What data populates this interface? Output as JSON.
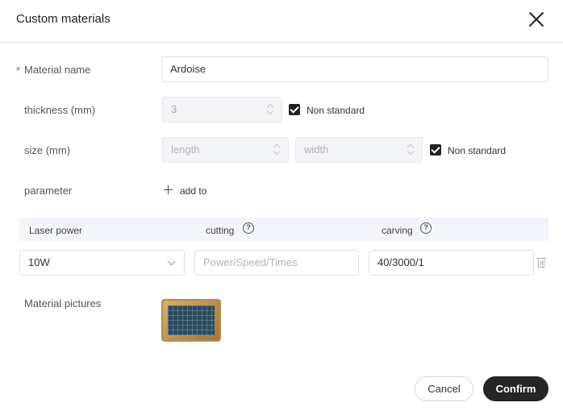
{
  "dialog": {
    "title": "Custom materials",
    "close_icon": "close-icon"
  },
  "form": {
    "material_name": {
      "required_mark": "*",
      "label": "Material name",
      "value": "Ardoise"
    },
    "thickness": {
      "label": "thickness (mm)",
      "value": "3",
      "non_standard_label": "Non standard",
      "non_standard_checked": true
    },
    "size": {
      "label": "size (mm)",
      "length_placeholder": "length",
      "width_placeholder": "width",
      "non_standard_label": "Non standard",
      "non_standard_checked": true
    },
    "parameter": {
      "label": "parameter",
      "add_label": "add to",
      "add_icon": "plus-icon"
    }
  },
  "table": {
    "headers": [
      "Laser power",
      "cutting",
      "carving"
    ],
    "help_icon": "help-circle-icon",
    "rows": [
      {
        "laser_power": "10W",
        "cutting_placeholder": "Power/Speed/Times",
        "carving_value": "40/3000/1",
        "delete_icon": "trash-icon"
      }
    ]
  },
  "pictures": {
    "label": "Material pictures",
    "image_icon": "slate-board-image"
  },
  "footer": {
    "cancel_label": "Cancel",
    "confirm_label": "Confirm"
  },
  "colors": {
    "primary_button": "#252525",
    "required_mark": "#e53935",
    "table_header_bg": "#f3f5fa"
  }
}
